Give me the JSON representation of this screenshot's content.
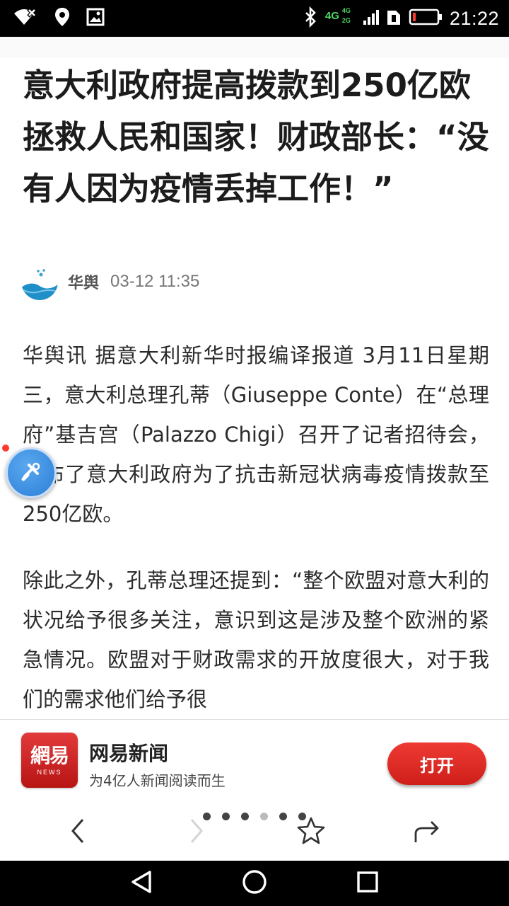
{
  "status_bar": {
    "time": "21:22",
    "network": {
      "primary": "4G",
      "secondary_top": "4G",
      "secondary_bottom": "2G"
    },
    "icons": [
      "wifi-x-icon",
      "location-pin-icon",
      "image-icon",
      "bluetooth-icon",
      "signal-icon",
      "sim-icon",
      "battery-low-icon"
    ],
    "battery_color": "#ff3b30",
    "network_color": "#4cd964"
  },
  "article": {
    "headline": "意大利政府提高拨款到250亿欧拯救人民和国家！财政部长：“没有人因为疫情丢掉工作！”",
    "source": "华舆",
    "published": "03-12 11:35",
    "paragraphs": [
      "华舆讯 据意大利新华时报编译报道 3月11日星期三，意大利总理孔蒂（Giuseppe Conte）在“总理府”基吉宫（Palazzo Chigi）召开了记者招待会，宣布了意大利政府为了抗击新冠状病毒疫情拨款至250亿欧。",
      "除此之外，孔蒂总理还提到：“整个欧盟对意大利的状况给予很多关注，意识到这是涉及整个欧洲的紧急情况。欧盟对于财政需求的开放度很大，对于我们的需求他们给予很"
    ]
  },
  "app_banner": {
    "logo_text": "網易",
    "logo_sub": "NEWS",
    "app_name": "网易新闻",
    "slogan": "为4亿人新闻阅读而生",
    "open_label": "打开",
    "accent_color": "#d9241d"
  },
  "browser_toolbar": {
    "page_dot_count": 6,
    "active_page_dot": 4,
    "buttons": [
      "back-icon",
      "forward-icon",
      "star-icon",
      "share-icon"
    ]
  },
  "nav_bar": {
    "buttons": [
      "nav-back-icon",
      "nav-home-icon",
      "nav-recents-icon"
    ]
  }
}
